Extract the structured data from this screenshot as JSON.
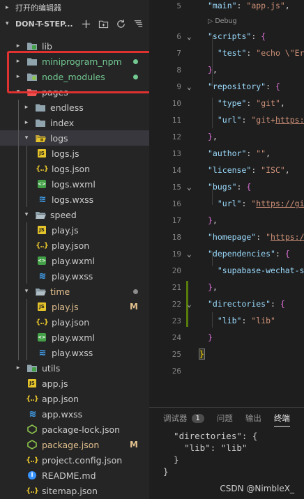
{
  "sidebar": {
    "open_editors_label": "打开的编辑器",
    "project_name": "DON-T-STEP...",
    "actions": [
      "new-file",
      "new-folder",
      "refresh",
      "collapse-all"
    ],
    "tree": [
      {
        "label": "lib",
        "type": "folder-lib",
        "depth": 1,
        "state": "collapsed"
      },
      {
        "label": "miniprogram_npm",
        "type": "folder",
        "depth": 1,
        "state": "collapsed",
        "color": "#73c991",
        "dot": "#73c991"
      },
      {
        "label": "node_modules",
        "type": "folder-node",
        "depth": 1,
        "state": "collapsed",
        "color": "#73c991",
        "dot": "#73c991"
      },
      {
        "label": "pages",
        "type": "folder-pages",
        "depth": 1,
        "state": "expanded"
      },
      {
        "label": "endless",
        "type": "folder",
        "depth": 2,
        "state": "collapsed"
      },
      {
        "label": "index",
        "type": "folder",
        "depth": 2,
        "state": "collapsed"
      },
      {
        "label": "logs",
        "type": "folder-logs",
        "depth": 2,
        "state": "expanded",
        "selected": true
      },
      {
        "label": "logs.js",
        "type": "js",
        "depth": 3
      },
      {
        "label": "logs.json",
        "type": "json",
        "depth": 3
      },
      {
        "label": "logs.wxml",
        "type": "wxml",
        "depth": 3
      },
      {
        "label": "logs.wxss",
        "type": "wxss",
        "depth": 3
      },
      {
        "label": "speed",
        "type": "folder-open",
        "depth": 2,
        "state": "expanded"
      },
      {
        "label": "play.js",
        "type": "js",
        "depth": 3
      },
      {
        "label": "play.json",
        "type": "json",
        "depth": 3
      },
      {
        "label": "play.wxml",
        "type": "wxml",
        "depth": 3
      },
      {
        "label": "play.wxss",
        "type": "wxss",
        "depth": 3
      },
      {
        "label": "time",
        "type": "folder-open",
        "depth": 2,
        "state": "expanded",
        "color": "#e2c08d",
        "dot": "#8c8c8c"
      },
      {
        "label": "play.js",
        "type": "js",
        "depth": 3,
        "color": "#e2c08d",
        "mark": "M"
      },
      {
        "label": "play.json",
        "type": "json",
        "depth": 3
      },
      {
        "label": "play.wxml",
        "type": "wxml",
        "depth": 3
      },
      {
        "label": "play.wxss",
        "type": "wxss",
        "depth": 3
      },
      {
        "label": "utils",
        "type": "folder-utils",
        "depth": 1,
        "state": "collapsed"
      },
      {
        "label": "app.js",
        "type": "js",
        "depth": 1
      },
      {
        "label": "app.json",
        "type": "json",
        "depth": 1
      },
      {
        "label": "app.wxss",
        "type": "wxss",
        "depth": 1
      },
      {
        "label": "package-lock.json",
        "type": "npm",
        "depth": 1
      },
      {
        "label": "package.json",
        "type": "npm",
        "depth": 1,
        "color": "#e2c08d",
        "mark": "M"
      },
      {
        "label": "project.config.json",
        "type": "json",
        "depth": 1
      },
      {
        "label": "README.md",
        "type": "info",
        "depth": 1
      },
      {
        "label": "sitemap.json",
        "type": "json",
        "depth": 1
      }
    ]
  },
  "editor": {
    "codelens": "Debug",
    "lines": [
      {
        "n": "5",
        "html": "<span class=\"k\">\"main\"</span><span class=\"p\">: </span><span class=\"s\">\"app.js\"</span><span class=\"p\">,</span>"
      },
      {
        "lens": true
      },
      {
        "n": "6",
        "fold": true,
        "html": "<span class=\"k\">\"scripts\"</span><span class=\"p\">: </span><span class=\"b2\">{</span>"
      },
      {
        "n": "7",
        "html": "  <span class=\"k\">\"test\"</span><span class=\"p\">: </span><span class=\"s\">\"echo \\\"Err</span>"
      },
      {
        "n": "8",
        "html": "<span class=\"b2\">}</span><span class=\"p\">,</span>"
      },
      {
        "n": "9",
        "fold": true,
        "html": "<span class=\"k\">\"repository\"</span><span class=\"p\">: </span><span class=\"b2\">{</span>"
      },
      {
        "n": "10",
        "html": "  <span class=\"k\">\"type\"</span><span class=\"p\">: </span><span class=\"s\">\"git\"</span><span class=\"p\">,</span>"
      },
      {
        "n": "11",
        "html": "  <span class=\"k\">\"url\"</span><span class=\"p\">: </span><span class=\"s\">\"git+</span><span class=\"u\">https:/</span>"
      },
      {
        "n": "12",
        "html": "<span class=\"b2\">}</span><span class=\"p\">,</span>"
      },
      {
        "n": "13",
        "html": "<span class=\"k\">\"author\"</span><span class=\"p\">: </span><span class=\"s\">\"\"</span><span class=\"p\">,</span>"
      },
      {
        "n": "14",
        "html": "<span class=\"k\">\"license\"</span><span class=\"p\">: </span><span class=\"s\">\"ISC\"</span><span class=\"p\">,</span>"
      },
      {
        "n": "15",
        "fold": true,
        "html": "<span class=\"k\">\"bugs\"</span><span class=\"p\">: </span><span class=\"b2\">{</span>"
      },
      {
        "n": "16",
        "html": "  <span class=\"k\">\"url\"</span><span class=\"p\">: </span><span class=\"s\">\"</span><span class=\"u\">https://git</span>"
      },
      {
        "n": "17",
        "html": "<span class=\"b2\">}</span><span class=\"p\">,</span>"
      },
      {
        "n": "18",
        "html": "<span class=\"k\">\"homepage\"</span><span class=\"p\">: </span><span class=\"s\">\"</span><span class=\"u\">https://</span>"
      },
      {
        "n": "19",
        "fold": true,
        "html": "<span class=\"k\">\"dependencies\"</span><span class=\"p\">: </span><span class=\"b2\">{</span>"
      },
      {
        "n": "20",
        "html": "  <span class=\"k\">\"supabase-wechat-st</span>"
      },
      {
        "n": "21",
        "html": "<span class=\"b2\">}</span><span class=\"p\">,</span>"
      },
      {
        "n": "22",
        "fold": true,
        "html": "<span class=\"k\">\"directories\"</span><span class=\"p\">: </span><span class=\"b2\">{</span>"
      },
      {
        "n": "23",
        "html": "  <span class=\"k\">\"lib\"</span><span class=\"p\">: </span><span class=\"s\">\"lib\"</span>"
      },
      {
        "n": "24",
        "html": "<span class=\"b2\">}</span>"
      },
      {
        "n": "25",
        "html": "<span class=\"b1\" style=\"margin-left:-12px;background:#3a3a2a;outline:1px solid #777;\">}</span>"
      },
      {
        "n": "26",
        "html": ""
      }
    ]
  },
  "panel": {
    "tabs": [
      {
        "label": "调试器",
        "badge": "1"
      },
      {
        "label": "问题"
      },
      {
        "label": "输出"
      },
      {
        "label": "终端",
        "active": true
      }
    ],
    "terminal_lines": [
      "  \"directories\": {",
      "    \"lib\": \"lib\"",
      "  }",
      "}"
    ]
  },
  "watermark": "CSDN @NimbleX_",
  "colors": {
    "highlight_box": "#e03131",
    "untracked": "#73c991",
    "modified": "#e2c08d"
  }
}
